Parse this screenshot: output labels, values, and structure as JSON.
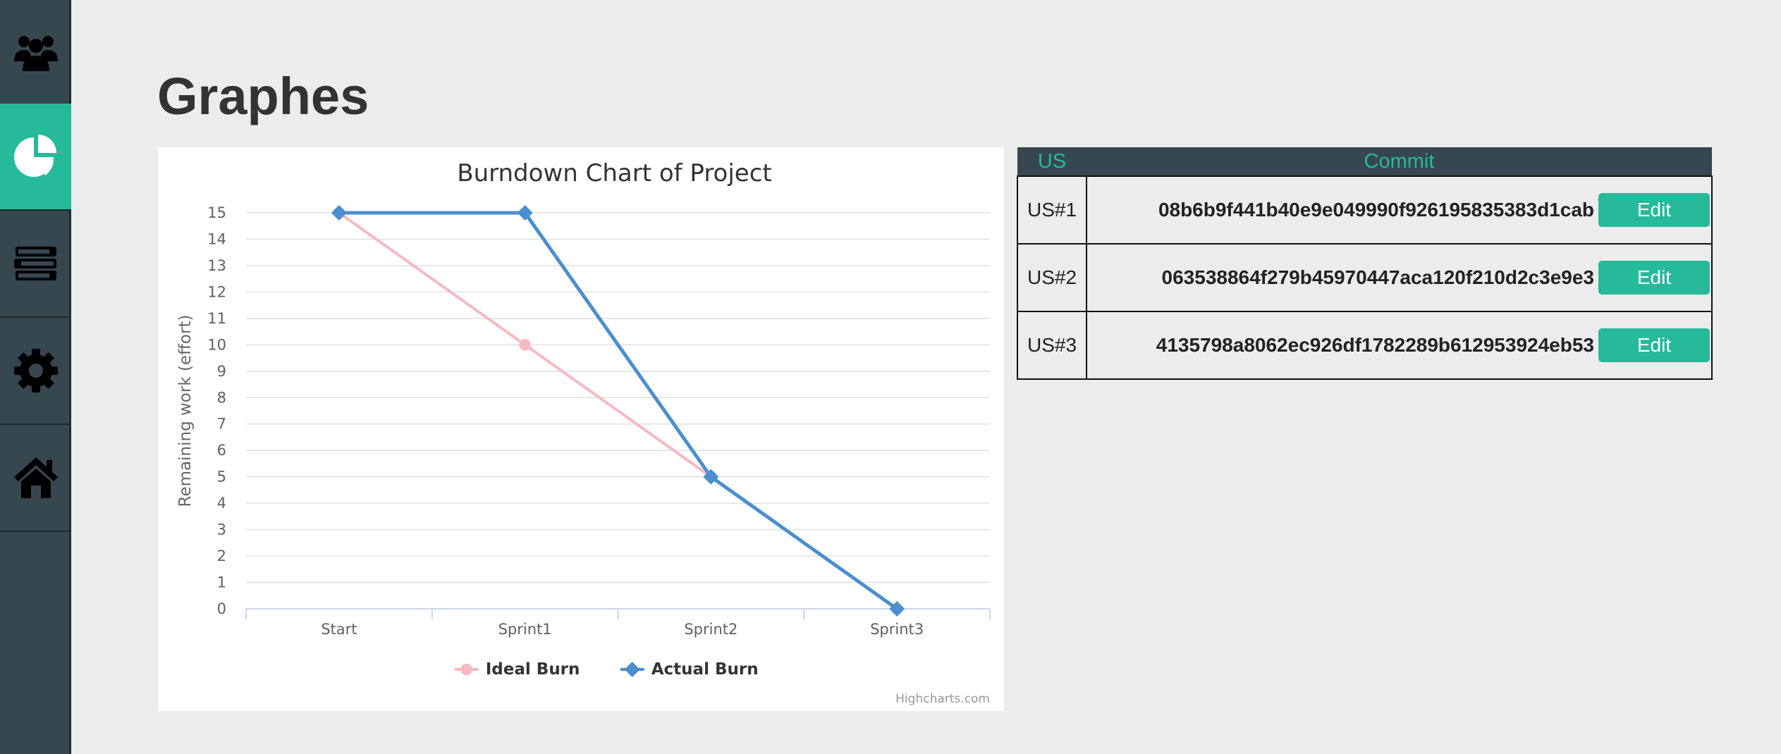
{
  "sidebar": {
    "items": [
      {
        "icon": "users-icon",
        "active": false
      },
      {
        "icon": "pie-chart-icon",
        "active": true
      },
      {
        "icon": "books-icon",
        "active": false
      },
      {
        "icon": "gear-icon",
        "active": false
      },
      {
        "icon": "home-icon",
        "active": false
      }
    ]
  },
  "page": {
    "title": "Graphes"
  },
  "chart_data": {
    "type": "line",
    "title": "Burndown Chart of Project",
    "xlabel": "",
    "ylabel": "Remaining work (effort)",
    "categories": [
      "Start",
      "Sprint1",
      "Sprint2",
      "Sprint3"
    ],
    "ylim": [
      0,
      15
    ],
    "yticks": [
      0,
      1,
      2,
      3,
      4,
      5,
      6,
      7,
      8,
      9,
      10,
      11,
      12,
      13,
      14,
      15
    ],
    "grid": true,
    "legend_position": "bottom-center",
    "credits": "Highcharts.com",
    "series": [
      {
        "name": "Ideal Burn",
        "values": [
          15,
          10,
          5,
          0
        ],
        "color": "#f7b9c0",
        "marker": "circle"
      },
      {
        "name": "Actual Burn",
        "values": [
          15,
          15,
          5,
          0
        ],
        "color": "#4a8fcf",
        "marker": "diamond"
      }
    ]
  },
  "table": {
    "headers": {
      "us": "US",
      "commit": "Commit"
    },
    "rows": [
      {
        "us": "US#1",
        "commit": "08b6b9f441b40e9e049990f926195835383d1cab",
        "action": "Edit"
      },
      {
        "us": "US#2",
        "commit": "063538864f279b45970447aca120f210d2c3e9e3",
        "action": "Edit"
      },
      {
        "us": "US#3",
        "commit": "4135798a8062ec926df1782289b612953924eb53",
        "action": "Edit"
      }
    ]
  },
  "colors": {
    "accent": "#26b99a",
    "sidebar": "#37474f",
    "background": "#ececec"
  }
}
